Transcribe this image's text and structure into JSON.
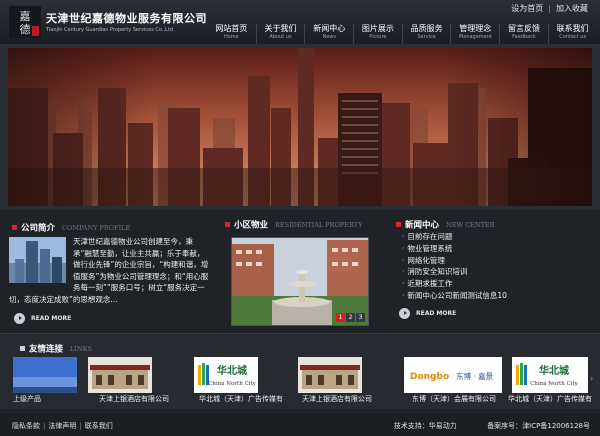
{
  "header": {
    "logo_seal_text": "嘉德",
    "title_cn": "天津世纪嘉德物业服务有限公司",
    "title_en": "Tianjin Century Guardian Property Services Co.,Ltd",
    "toplinks": [
      "设为首页",
      "加入收藏"
    ]
  },
  "nav": [
    {
      "cn": "网站首页",
      "en": "Home"
    },
    {
      "cn": "关于我们",
      "en": "About us"
    },
    {
      "cn": "新闻中心",
      "en": "News"
    },
    {
      "cn": "图片展示",
      "en": "Picture"
    },
    {
      "cn": "品质服务",
      "en": "Service"
    },
    {
      "cn": "管理理念",
      "en": "Management"
    },
    {
      "cn": "留言反馈",
      "en": "Feedback"
    },
    {
      "cn": "联系我们",
      "en": "Contact us"
    }
  ],
  "company": {
    "title_cn": "公司简介",
    "title_en": "COMPANY PROFILE",
    "text": "天津世纪嘉德物业公司创建至今，秉承“融慧至勤，让业主共赢；乐于奉献，做行业先锋”的企业宗旨，“构建和谐，增值服务”为物业公司管理理念；和“用心服务每一刻”“服务口号；树立“服务决定一切，态度决定成败”的思想观念...",
    "more": "READ MORE"
  },
  "residential": {
    "title_cn": "小区物业",
    "title_en": "RESIDENTIAL PROPERTY",
    "pages": [
      "1",
      "2",
      "3"
    ],
    "active_page": "1"
  },
  "news": {
    "title_cn": "新闻中心",
    "title_en": "NEW CENTER",
    "items": [
      "目前存在问题",
      "物业管理系统",
      "网络化管理",
      "消防安全知识培训",
      "近期求援工作",
      "新闻中心公司新闻测试信息10"
    ],
    "more": "READ MORE"
  },
  "links": {
    "title_cn": "友情连接",
    "title_en": "LINKS",
    "items": [
      {
        "caption": "上级产品",
        "logo": "photo-sky"
      },
      {
        "caption": "天津上银酒店有限公司",
        "logo": "photo-hotel"
      },
      {
        "caption": "华北城（天津）广告传媒有",
        "logo": "china-north-city",
        "logo_cn": "华北城",
        "logo_en": "China North City"
      },
      {
        "caption": "天津上银酒店有限公司",
        "logo": "photo-hotel"
      },
      {
        "caption": "东博（天津）会展有限公司",
        "logo": "dongbo",
        "logo_left": "Dongbo",
        "logo_right": "东博 · 嘉景"
      },
      {
        "caption": "华北城（天津）广告传媒有",
        "logo": "china-north-city",
        "logo_cn": "华北城",
        "logo_en": "China North City"
      }
    ]
  },
  "footer": {
    "links": [
      "隐私条款",
      "法律声明",
      "联系我们"
    ],
    "support_label": "技术支持：",
    "support_value": "华易动力",
    "icp_label": "备案序号：",
    "icp_value": "津ICP备12006128号"
  },
  "colors": {
    "accent": "#d9232d",
    "background": "#1f2328"
  }
}
